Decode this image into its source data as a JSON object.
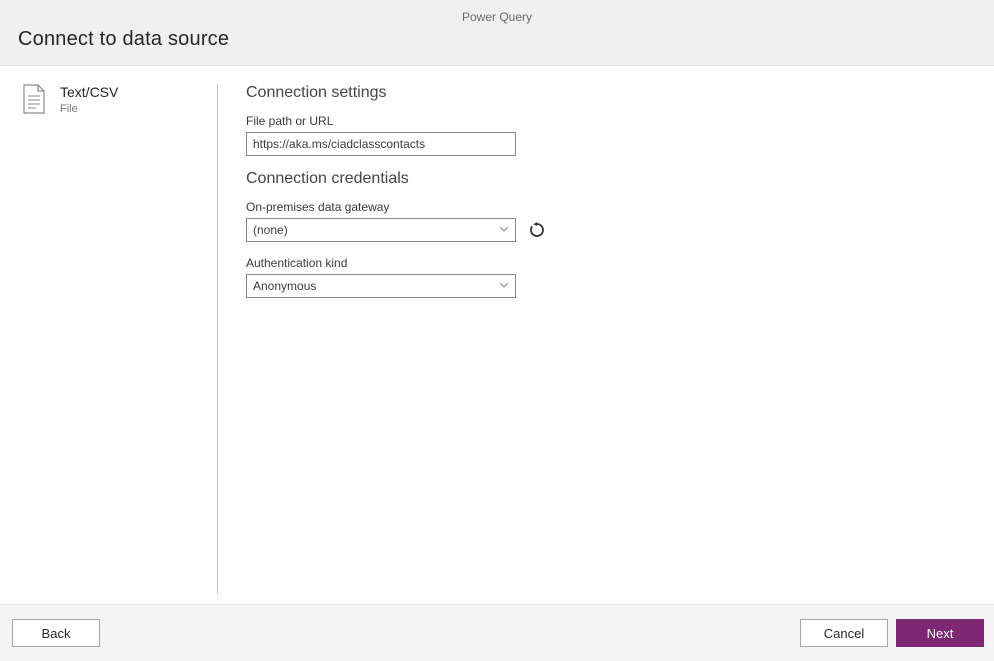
{
  "app": {
    "name": "Power Query"
  },
  "page": {
    "title": "Connect to data source"
  },
  "source": {
    "name": "Text/CSV",
    "kind": "File"
  },
  "settings": {
    "title": "Connection settings",
    "file_path": {
      "label": "File path or URL",
      "value": "https://aka.ms/ciadclasscontacts"
    }
  },
  "credentials": {
    "title": "Connection credentials",
    "gateway": {
      "label": "On-premises data gateway",
      "value": "(none)"
    },
    "auth": {
      "label": "Authentication kind",
      "value": "Anonymous"
    }
  },
  "footer": {
    "back": "Back",
    "cancel": "Cancel",
    "next": "Next"
  },
  "colors": {
    "primary": "#7e2772"
  }
}
